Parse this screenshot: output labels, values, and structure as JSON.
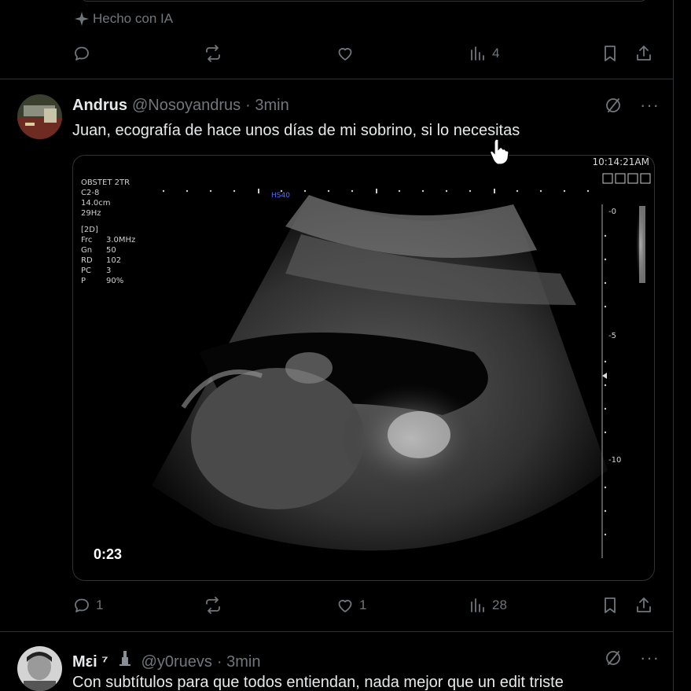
{
  "prev_post": {
    "ai_label": "Hecho con IA",
    "views": "4"
  },
  "post1": {
    "name": "Andrus",
    "handle": "@Nosoyandrus",
    "time": "· 3min",
    "text": "Juan, ecografía de hace unos días de mi sobrino, si lo necesitas",
    "media": {
      "clock": "10:14:21AM",
      "preset": "OBSTET 2TR",
      "probe": "C2-8",
      "depth": "14.0cm",
      "rate": "29Hz",
      "mode": "[2D]",
      "params": [
        {
          "k": "Frc",
          "v": "3.0MHz"
        },
        {
          "k": "Gn",
          "v": "50"
        },
        {
          "k": "RD",
          "v": "102"
        },
        {
          "k": "PC",
          "v": "3"
        },
        {
          "k": "P",
          "v": "90%"
        }
      ],
      "marker": "HS40",
      "scale": [
        "0",
        "5",
        "10"
      ],
      "duration": "0:23"
    },
    "replies": "1",
    "likes": "1",
    "views": "28"
  },
  "post2": {
    "name": "Mεi ⁷",
    "handle": "@y0ruevs",
    "time": "· 3min",
    "text": "Con subtítulos para que todos entiendan, nada mejor que un edit triste"
  },
  "icons": [
    "reply-icon",
    "repost-icon",
    "like-icon",
    "views-icon",
    "bookmark-icon",
    "share-icon",
    "grok-icon",
    "more-icon",
    "sparkle-icon"
  ],
  "colors": {
    "background": "#000000",
    "text": "#e7e9ea",
    "muted": "#71767b",
    "border": "#2f3336"
  }
}
